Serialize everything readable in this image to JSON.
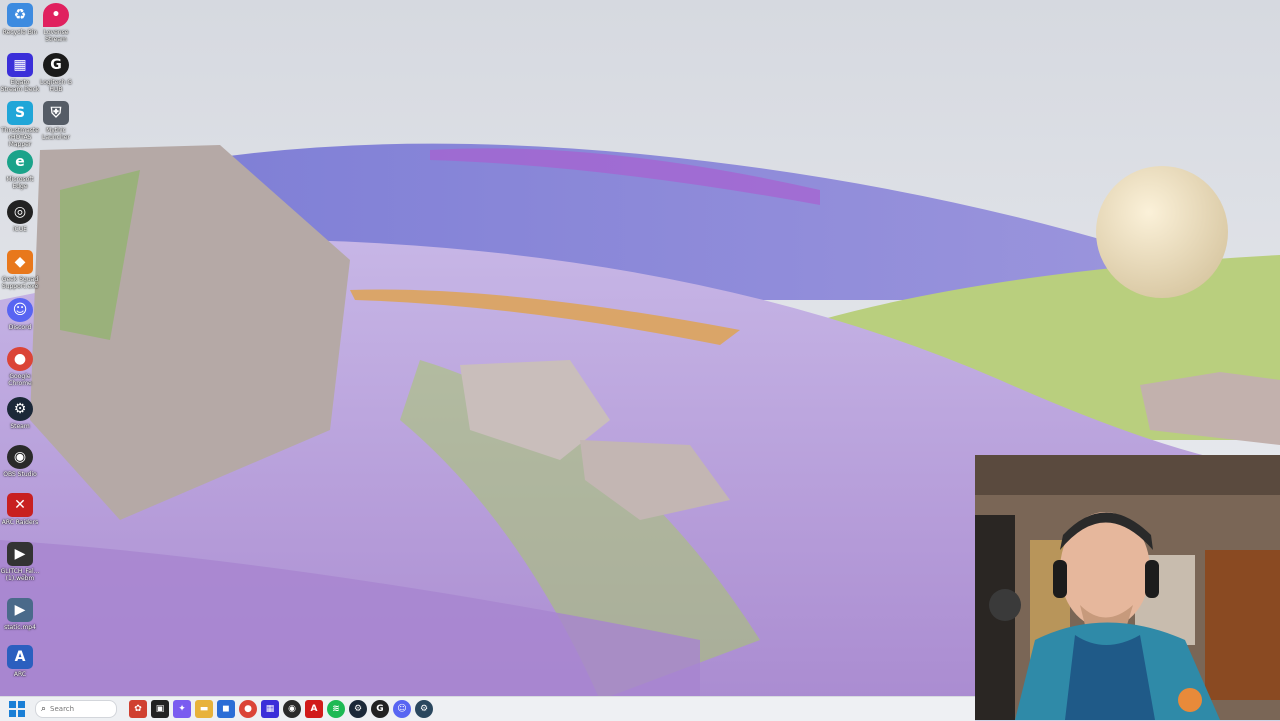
{
  "desktop": {
    "icons": [
      {
        "label": "Recycle Bin",
        "icon": "recycle-bin-icon",
        "color": "#3d8be0"
      },
      {
        "label": "Lovense Stream",
        "icon": "location-pin-icon",
        "color": "#e0215f"
      },
      {
        "label": "Elgato Stream Deck",
        "icon": "stream-deck-icon",
        "color": "#3b2fd9"
      },
      {
        "label": "Logitech G HUB",
        "icon": "logitech-g-icon",
        "color": "#1a1a1a"
      },
      {
        "label": "ThrustmasterHOTAS Mapper",
        "icon": "thrustmaster-icon",
        "color": "#20a6d8"
      },
      {
        "label": "Mythic Launcher",
        "icon": "shield-icon",
        "color": "#555c66"
      },
      {
        "label": "Microsoft Edge",
        "icon": "edge-icon",
        "color": "#1ba38a"
      },
      {
        "label": "iCUE",
        "icon": "icue-icon",
        "color": "#222222"
      },
      {
        "label": "Geek Squad Support.exe",
        "icon": "geek-squad-icon",
        "color": "#e8781c"
      },
      {
        "label": "Discord",
        "icon": "discord-icon",
        "color": "#5865f2"
      },
      {
        "label": "Google Chrome",
        "icon": "chrome-icon",
        "color": "#db4437"
      },
      {
        "label": "Steam",
        "icon": "steam-icon",
        "color": "#1b2838"
      },
      {
        "label": "OBS Studio",
        "icon": "obs-icon",
        "color": "#2a2a2a"
      },
      {
        "label": "ARC Raiders",
        "icon": "arc-raiders-icon",
        "color": "#c82020"
      },
      {
        "label": "GLITCH_Fal... (1).webm",
        "icon": "video-file-icon",
        "color": "#333333"
      },
      {
        "label": "static.mp4",
        "icon": "video-file-icon",
        "color": "#4a6a8a"
      },
      {
        "label": "ARC",
        "icon": "arc-icon",
        "color": "#2b5fbf"
      }
    ]
  },
  "taskbar": {
    "search_placeholder": "Search",
    "pinned": [
      {
        "icon": "widgets-icon",
        "color": "#d04030",
        "glyph": "✿"
      },
      {
        "icon": "task-view-icon",
        "color": "#222222",
        "glyph": "▣"
      },
      {
        "icon": "copilot-icon",
        "color": "#7a5cf0",
        "glyph": "✦"
      },
      {
        "icon": "file-explorer-icon",
        "color": "#e8b23a",
        "glyph": "▬"
      },
      {
        "icon": "store-icon",
        "color": "#2b6dd6",
        "glyph": "◼"
      },
      {
        "icon": "chrome-icon",
        "color": "#db4437",
        "glyph": "●"
      },
      {
        "icon": "stream-deck-icon",
        "color": "#3b2fd9",
        "glyph": "▦"
      },
      {
        "icon": "obs-icon",
        "color": "#2a2a2a",
        "glyph": "◉"
      },
      {
        "icon": "adobe-icon",
        "color": "#d11a1a",
        "glyph": "A"
      },
      {
        "icon": "spotify-icon",
        "color": "#1db954",
        "glyph": "≋"
      },
      {
        "icon": "steam-icon",
        "color": "#1b2838",
        "glyph": "⚙"
      },
      {
        "icon": "logitech-g-icon",
        "color": "#222222",
        "glyph": "G"
      },
      {
        "icon": "discord-icon",
        "color": "#5865f2",
        "glyph": "☺"
      },
      {
        "icon": "steam-icon",
        "color": "#2a475e",
        "glyph": "⚙"
      }
    ]
  }
}
